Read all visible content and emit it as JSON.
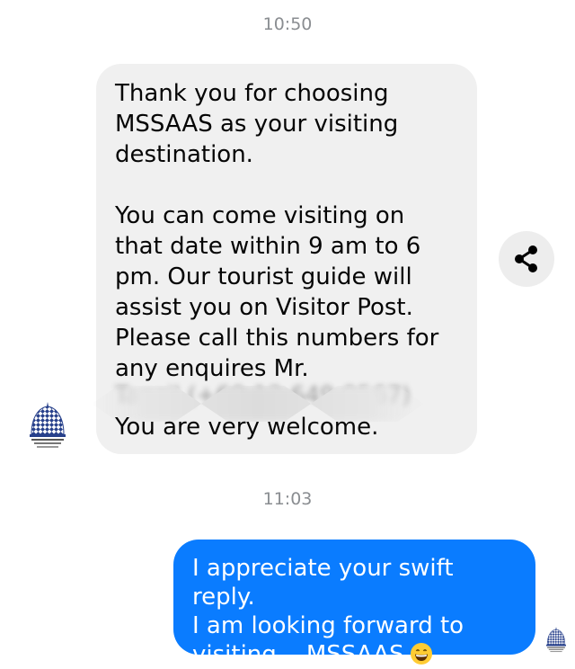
{
  "conversation": {
    "timestamp_1": "10:50",
    "timestamp_2": "11:03"
  },
  "incoming_message": {
    "paragraph_1": "Thank you for choosing MSSAAS as your visiting destination.",
    "paragraph_2": "You can come visiting on that date within 9 am to 6 pm. Our tourist guide will assist you on Visitor Post. Please call this numbers for any enquires Mr.",
    "redacted_fragment": "Tanzil (+60 12 649 0567)",
    "paragraph_3": "You are very welcome."
  },
  "outgoing_message": {
    "line_1": "I appreciate your swift reply.",
    "line_2": "I am looking forward to",
    "line_3": "visiting",
    "line_3_name": "MSSAAS",
    "emoji": "grinning-face-emoji"
  },
  "icons": {
    "share": "share-icon",
    "sender_avatar": "mosque-dome-avatar",
    "read_receipt": "mosque-dome-avatar"
  },
  "colors": {
    "incoming_bubble": "#f0f0f0",
    "outgoing_bubble": "#0a7cff",
    "timestamp": "#8a8d91"
  }
}
